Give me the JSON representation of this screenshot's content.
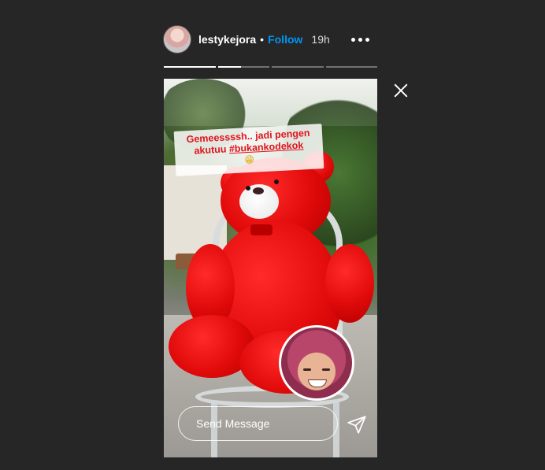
{
  "header": {
    "username": "lestykejora",
    "separator": "•",
    "follow_label": "Follow",
    "time_ago": "19h"
  },
  "progress": {
    "segments": 4,
    "current_segment_fill": 0.45
  },
  "story": {
    "caption_line1": "Gemeessssh.. jadi pengen",
    "caption_line2_prefix": "akutuu ",
    "caption_hashtag": "#bukankodekok",
    "caption_emoji": "😁"
  },
  "reply": {
    "placeholder": "Send Message"
  },
  "icons": {
    "more": "more-options-icon",
    "close": "close-icon",
    "send": "send-icon"
  },
  "colors": {
    "background": "#262626",
    "follow": "#0095f6",
    "caption_text": "#e0141b"
  }
}
